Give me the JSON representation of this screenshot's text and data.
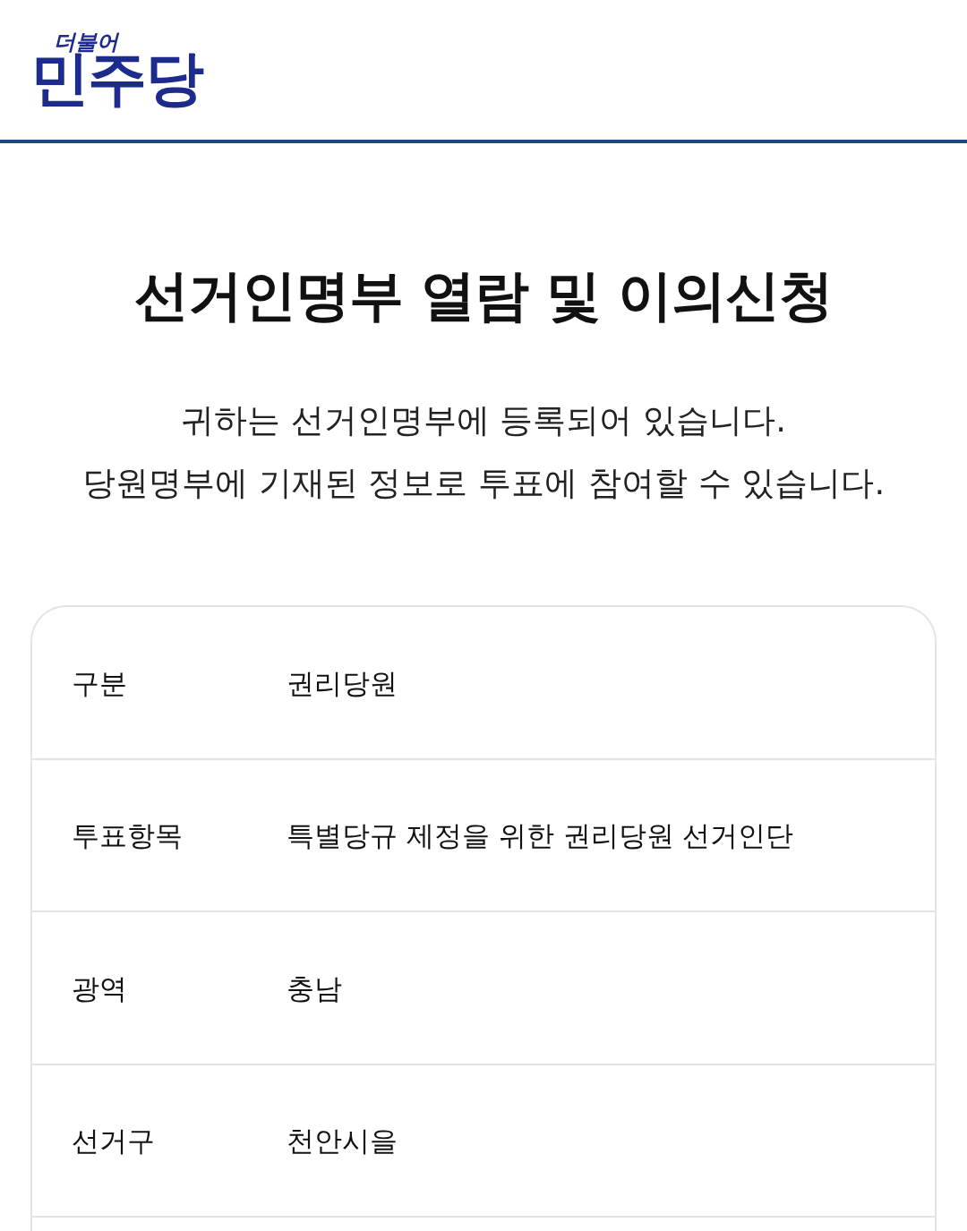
{
  "header": {
    "logo": {
      "tagline": "더불어",
      "wordmark": "민주당"
    }
  },
  "title": "선거인명부 열람 및 이의신청",
  "message": [
    "귀하는 선거인명부에 등록되어 있습니다.",
    "당원명부에 기재된 정보로 투표에 참여할 수 있습니다."
  ],
  "info_table": {
    "rows": [
      {
        "label": "구분",
        "value": "권리당원"
      },
      {
        "label": "투표항목",
        "value": "특별당규 제정을 위한 권리당원 선거인단"
      },
      {
        "label": "광역",
        "value": "충남"
      },
      {
        "label": "선거구",
        "value": "천안시을"
      }
    ]
  }
}
